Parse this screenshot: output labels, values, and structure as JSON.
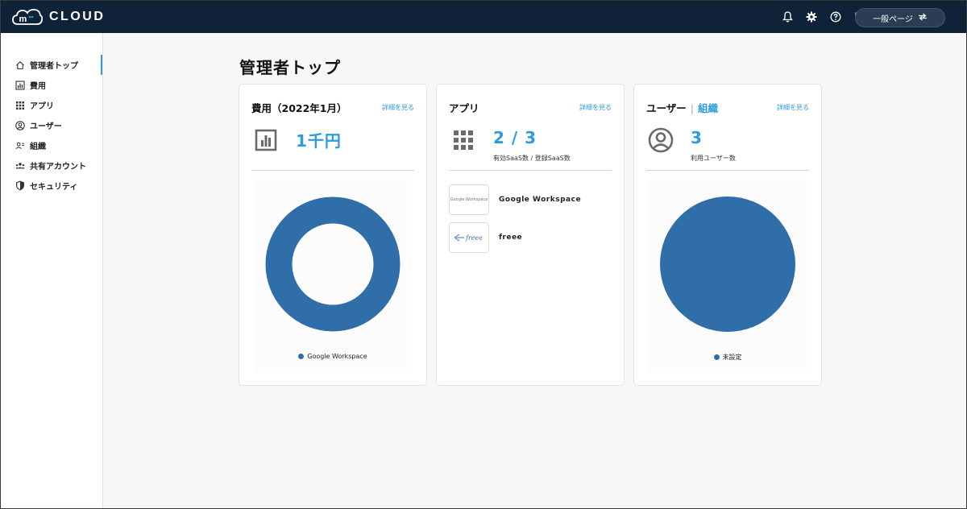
{
  "header": {
    "logo_text": "CLOUD",
    "logo_mark": "m",
    "page_switch_label": "一般ページ",
    "icons": [
      "bell-icon",
      "gear-icon",
      "help-icon",
      "shield-icon",
      "switch-arrows-icon"
    ]
  },
  "sidebar": {
    "items": [
      {
        "label": "管理者トップ",
        "icon": "home-icon"
      },
      {
        "label": "費用",
        "icon": "bar-chart-icon"
      },
      {
        "label": "アプリ",
        "icon": "grid-icon"
      },
      {
        "label": "ユーザー",
        "icon": "user-circle-icon"
      },
      {
        "label": "組織",
        "icon": "org-icon"
      },
      {
        "label": "共有アカウント",
        "icon": "shared-users-icon"
      },
      {
        "label": "セキュリティ",
        "icon": "shield-check-icon"
      }
    ]
  },
  "main": {
    "title": "管理者トップ",
    "cards": {
      "cost": {
        "title": "費用（2022年1月）",
        "detail_link": "詳細を見る",
        "value": "1千円",
        "chart": {
          "type": "donut",
          "legend": "Google Workspace",
          "values": [
            100
          ]
        }
      },
      "apps": {
        "title": "アプリ",
        "detail_link": "詳細を見る",
        "value": "2 / 3",
        "sub_label": "有効SaaS数 / 登録SaaS数",
        "list": [
          {
            "name": "Google Workspace",
            "logo_text": "Google Workspace"
          },
          {
            "name": "freee",
            "logo_text": "freee"
          }
        ]
      },
      "users": {
        "title": "ユーザー",
        "title_sep": "|",
        "title_link": "組織",
        "detail_link": "詳細を見る",
        "value": "3",
        "sub_label": "利用ユーザー数",
        "chart": {
          "type": "pie",
          "legend": "未設定",
          "values": [
            3
          ]
        }
      }
    }
  },
  "colors": {
    "header_bg": "#0f2238",
    "accent": "#2d9bdc",
    "chart_fill": "#2f6ea8"
  }
}
